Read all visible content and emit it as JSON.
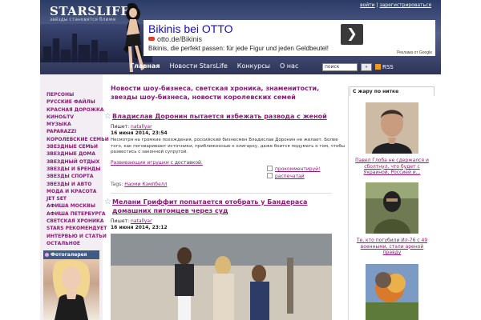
{
  "header": {
    "logo": "STARSLIFE",
    "tagline": "звёзды становятся ближе",
    "auth_login": "войти",
    "auth_register": "зарегистрироваться",
    "nav": [
      "Главная",
      "Новости StarsLife",
      "Конкурсы",
      "О нас"
    ],
    "search_placeholder": "поиск",
    "rss_label": "RSS"
  },
  "ad": {
    "title": "Bikinis bei OTTO",
    "url": "otto.de/Bikinis",
    "desc": "Bikinis, die perfekt passen: für jede Figur und jeden Geldbeutel!",
    "arrow": "❯",
    "google": "Реклама от Google"
  },
  "menu": [
    "ПЕРСОНЫ",
    "РУССКИЕ ФАЙЛЫ",
    "КРАСНАЯ ДОРОЖКА",
    "КИНО&TV",
    "МУЗЫКА",
    "PAPARAZZI",
    "КОРОЛЕВСКИЕ СЕМЬИ",
    "ЗВЕЗДНЫЕ СЕМЬИ",
    "ЗВЕЗДНЫЕ ДОМА",
    "ЗВЕЗДНЫЙ ОТДЫХ",
    "ЗВЕЗДЫ И БРЕНДЫ",
    "ЗВЕЗДЫ СПОРТА",
    "ЗВЕЗДЫ И АВТО",
    "МОДА И КРАСОТА",
    "JET SET",
    "АФИША МОСКВЫ",
    "АФИША ПЕТЕРБУРГА",
    "СВЕТСКАЯ ХРОНИКА",
    "STARS РЕКОМЕНДУЕТ",
    "ИНТЕРВЬЮ И СТАТЬИ",
    "ОСТАЛЬНОЕ"
  ],
  "gallery_title": "Фотогалерея",
  "main": {
    "heading": "Новости шоу-бизнеса, светская хроника, знаменитости, звезды шоу-бизнеса, новости королевских семей",
    "article1": {
      "title": "Владислав Доронин пытается избежать развода с женой",
      "author_label": "Пишет:",
      "author": "natallyar",
      "date": "16 июня 2014, 23:54",
      "body": "Несмотря на громкие похождения, российский бизнесмен Владислав Доронин не желает. Более того, как поговаривают источники, приближенные к олигарху, даже боится подумать о том, чтобы развестись с законной супругой.",
      "link": "Развивающие игрушки",
      "link_suffix": "с доставкой.",
      "comment": "прокомментируй!",
      "share": "распечатай",
      "tags_label": "Tags:",
      "tag": "Наоми Кэмпбелл"
    },
    "article2": {
      "title": "Мелани Гриффит попытается отобрать у Бандераса домашних питомцев через суд",
      "author_label": "Пишет:",
      "author": "natallyar",
      "date": "16 июня 2014, 23:12"
    }
  },
  "sidebar": {
    "title": "С жару по нитке",
    "items": [
      {
        "caption": "Павел Глоба не сдержался и сболтнул, что будет с Украиной, Россией и..."
      },
      {
        "caption": "Те, кто погубили Ил-76 с 49 военными, стали ареной правду"
      },
      {
        "caption": ""
      }
    ]
  }
}
